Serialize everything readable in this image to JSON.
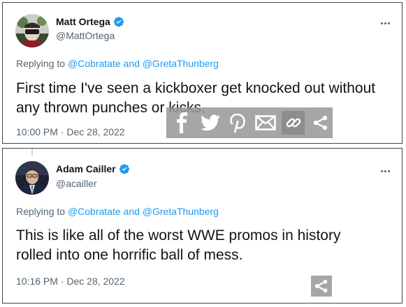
{
  "tweets": [
    {
      "name": "Matt Ortega",
      "handle": "@MattOrtega",
      "replying_prefix": "Replying to",
      "mention_1": "@Cobratate",
      "mention_joiner": "and",
      "mention_2": "@GretaThunberg",
      "text": "First time I've seen a kickboxer get knocked out without any thrown punches or kicks.",
      "timestamp": "10:00 PM · Dec 28, 2022"
    },
    {
      "name": "Adam Cailler",
      "handle": "@acailler",
      "replying_prefix": "Replying to",
      "mention_1": "@Cobratate",
      "mention_joiner": "and",
      "mention_2": "@GretaThunberg",
      "text": "This is like all of the worst WWE promos in history rolled into one horrific ball of mess.",
      "timestamp": "10:16 PM · Dec 28, 2022"
    }
  ],
  "icons": {
    "verified": "verified-badge-icon",
    "more": "more-options-icon",
    "share_bar": [
      "facebook-icon",
      "twitter-icon",
      "pinterest-icon",
      "email-icon",
      "link-icon",
      "share-icon"
    ]
  },
  "colors": {
    "link": "#1d9bf0",
    "verified": "#1d9bf0",
    "text": "#0f1419",
    "secondary": "#536471",
    "share_overlay": "#969696"
  }
}
